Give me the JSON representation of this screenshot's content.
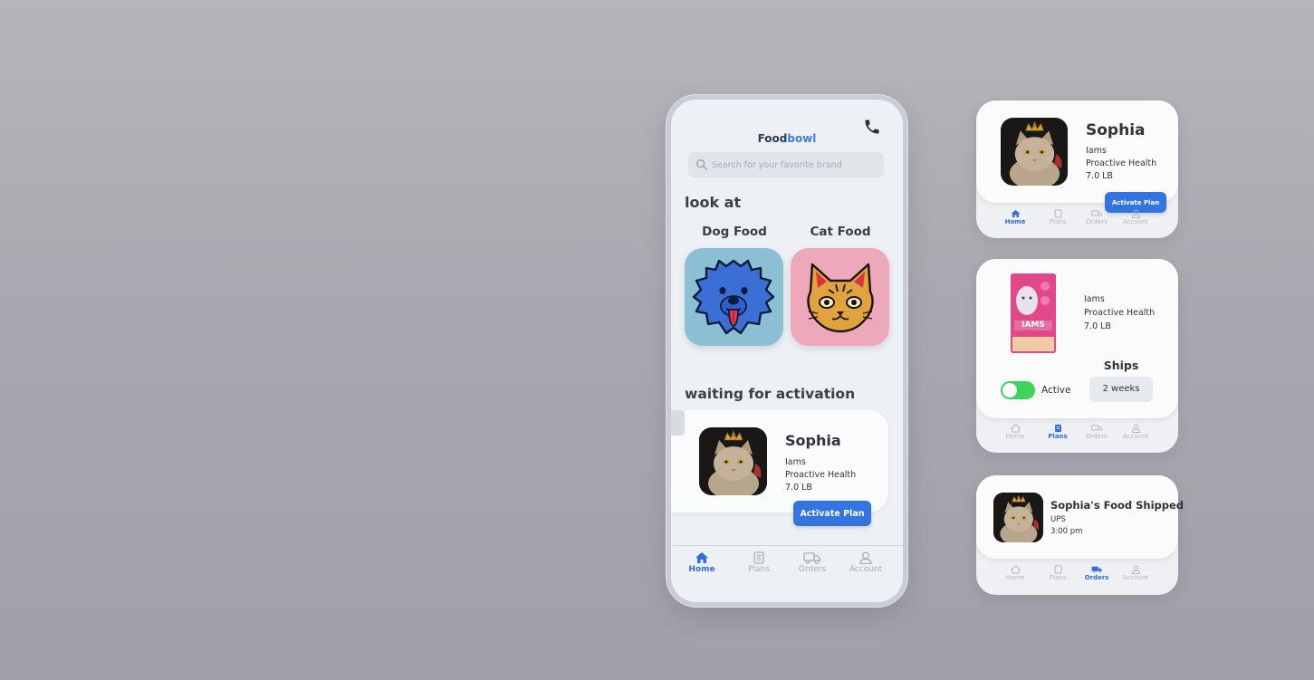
{
  "phone": {
    "brand_part1": "Food",
    "brand_part2": "bowl",
    "search_placeholder": "Search for your favorite brand",
    "look_at_heading": "look at",
    "categories": [
      {
        "label": "Dog Food"
      },
      {
        "label": "Cat Food"
      }
    ],
    "waiting_heading": "waiting for activation",
    "waiting_card": {
      "name": "Sophia",
      "brand": "Iams",
      "product": "Proactive Health",
      "weight": "7.0 LB",
      "button": "Activate Plan"
    },
    "nav": [
      {
        "label": "Home",
        "icon": "home-icon",
        "active": true
      },
      {
        "label": "Plans",
        "icon": "plans-icon",
        "active": false
      },
      {
        "label": "Orders",
        "icon": "truck-icon",
        "active": false
      },
      {
        "label": "Account",
        "icon": "user-icon",
        "active": false
      }
    ]
  },
  "card_home": {
    "name": "Sophia",
    "brand": "Iams",
    "product": "Proactive Health",
    "weight": "7.0 LB",
    "button": "Activate Plan",
    "nav": [
      "Home",
      "Plans",
      "Orders",
      "Account"
    ],
    "active_nav": "Home"
  },
  "card_plans": {
    "brand": "Iams",
    "product": "Proactive Health",
    "weight": "7.0 LB",
    "package_text": "IAMS",
    "toggle_label": "Active",
    "toggle_on": true,
    "ships_label": "Ships every",
    "ships_value": "2 weeks",
    "nav": [
      "Home",
      "Plans",
      "Orders",
      "Account"
    ],
    "active_nav": "Plans"
  },
  "card_orders": {
    "title": "Sophia's Food Shipped",
    "carrier": "UPS",
    "time": "3:00 pm",
    "nav": [
      "Home",
      "Plans",
      "Orders",
      "Account"
    ],
    "active_nav": "Orders"
  },
  "colors": {
    "accent": "#3474e0",
    "toggle_on": "#3ed35a",
    "dog_tile": "#8bbfd3",
    "cat_tile": "#eea8bb"
  }
}
